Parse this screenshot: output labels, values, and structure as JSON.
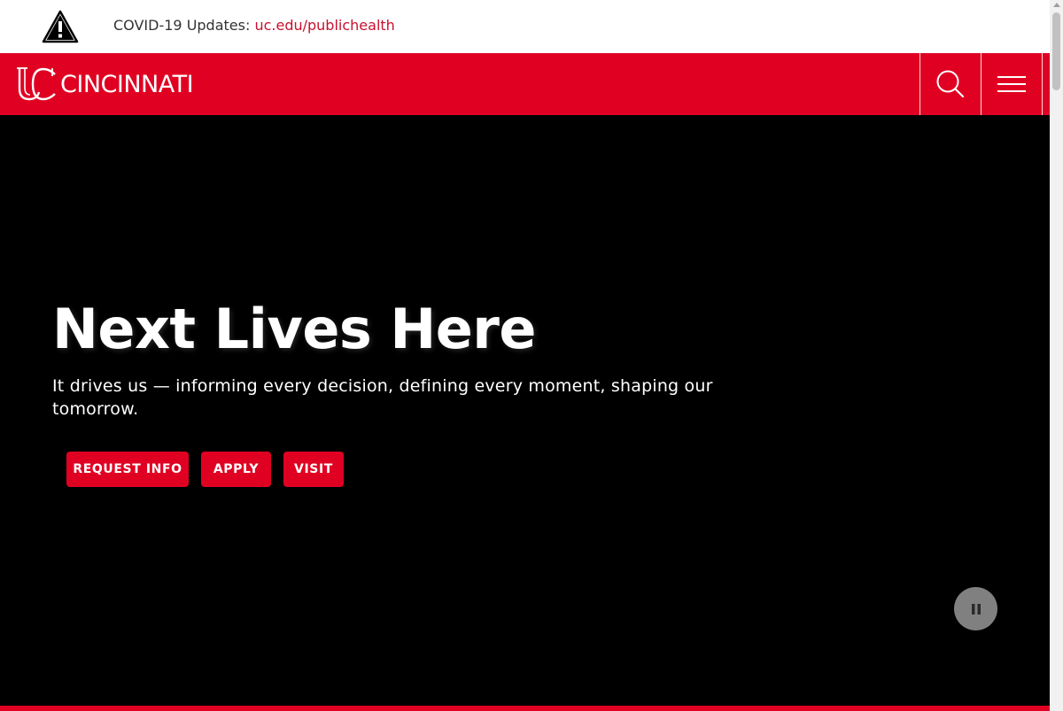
{
  "alert": {
    "icon": "warning-icon",
    "label": "COVID-19 Updates: ",
    "link_text": "uc.edu/publichealth"
  },
  "header": {
    "logo_text": "CINCINNATI",
    "logo_icon": "uc-logo-icon",
    "search_icon": "search-icon",
    "menu_icon": "hamburger-menu-icon"
  },
  "hero": {
    "title": "Next Lives Here",
    "subtitle": "It drives us — informing every decision, defining every moment, shaping our tomorrow.",
    "buttons": {
      "request_info": "REQUEST INFO",
      "apply": "APPLY",
      "visit": "VISIT"
    },
    "pause_icon": "pause-icon"
  },
  "colors": {
    "brand_red": "#e00122",
    "link_red": "#c8102e",
    "hero_bg": "#000000"
  }
}
